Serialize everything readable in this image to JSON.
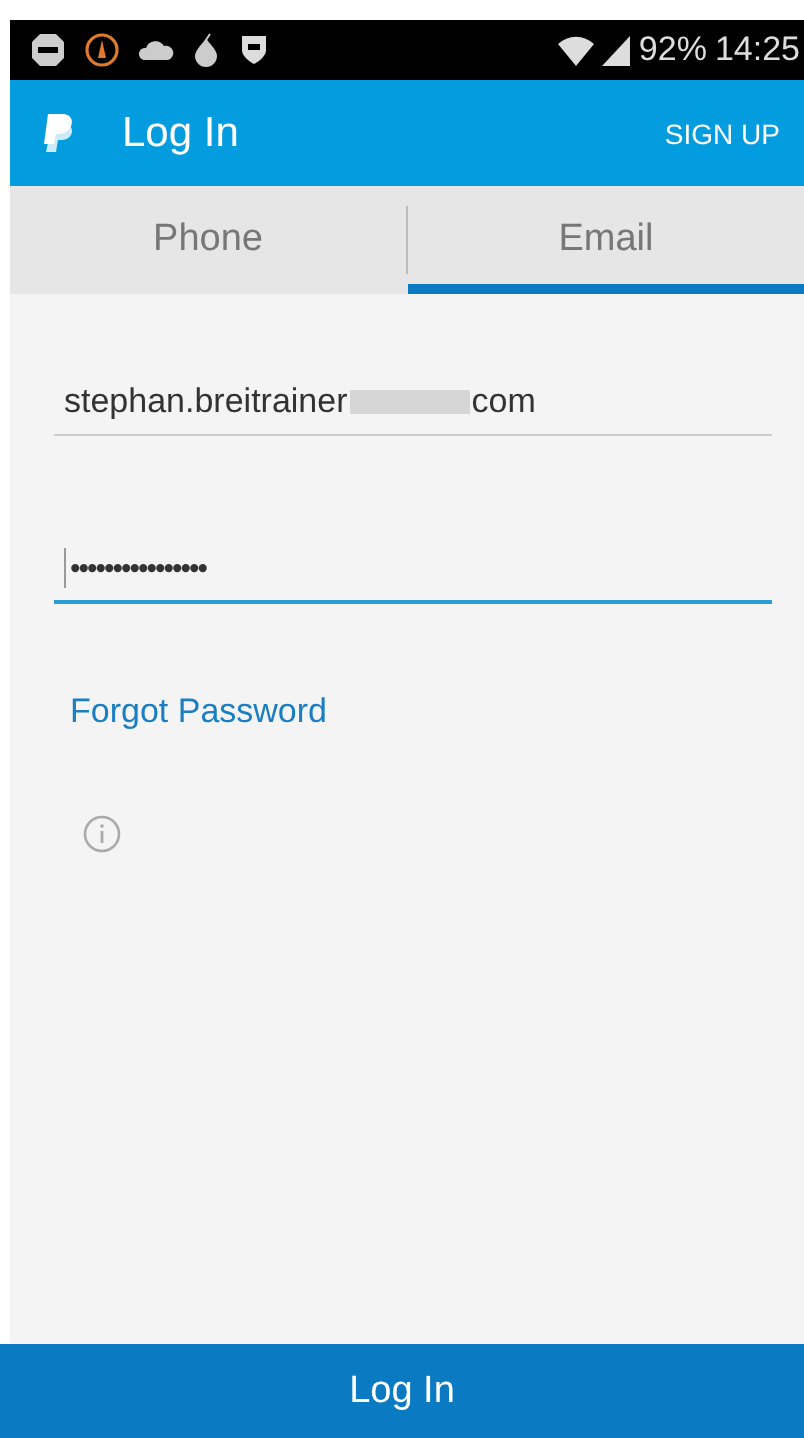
{
  "status_bar": {
    "battery": "92%",
    "time": "14:25"
  },
  "app_bar": {
    "title": "Log In",
    "action": "SIGN UP"
  },
  "tabs": [
    {
      "label": "Phone",
      "selected": false
    },
    {
      "label": "Email",
      "selected": true
    }
  ],
  "email_field": {
    "value_start": "stephan.breitrainer",
    "value_end": "com",
    "redacted": true,
    "focused": false
  },
  "password_field": {
    "value": "••••••••••••••••",
    "focused": true
  },
  "forgot_link": "Forgot Password",
  "login_button": "Log In"
}
